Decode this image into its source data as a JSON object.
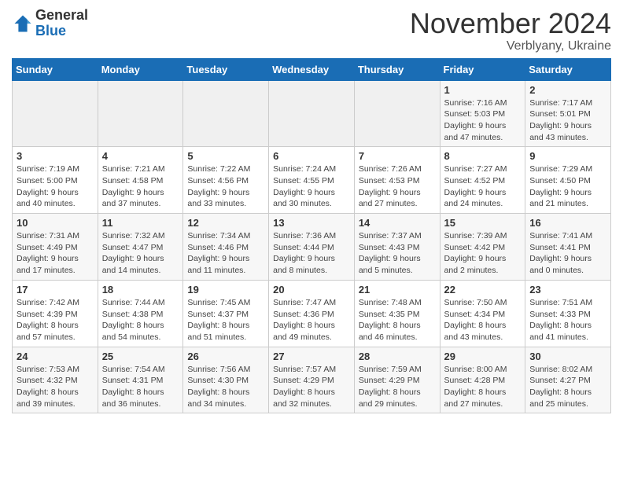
{
  "logo": {
    "general": "General",
    "blue": "Blue"
  },
  "title": "November 2024",
  "location": "Verblyany, Ukraine",
  "days_of_week": [
    "Sunday",
    "Monday",
    "Tuesday",
    "Wednesday",
    "Thursday",
    "Friday",
    "Saturday"
  ],
  "weeks": [
    [
      {
        "day": "",
        "info": ""
      },
      {
        "day": "",
        "info": ""
      },
      {
        "day": "",
        "info": ""
      },
      {
        "day": "",
        "info": ""
      },
      {
        "day": "",
        "info": ""
      },
      {
        "day": "1",
        "info": "Sunrise: 7:16 AM\nSunset: 5:03 PM\nDaylight: 9 hours\nand 47 minutes."
      },
      {
        "day": "2",
        "info": "Sunrise: 7:17 AM\nSunset: 5:01 PM\nDaylight: 9 hours\nand 43 minutes."
      }
    ],
    [
      {
        "day": "3",
        "info": "Sunrise: 7:19 AM\nSunset: 5:00 PM\nDaylight: 9 hours\nand 40 minutes."
      },
      {
        "day": "4",
        "info": "Sunrise: 7:21 AM\nSunset: 4:58 PM\nDaylight: 9 hours\nand 37 minutes."
      },
      {
        "day": "5",
        "info": "Sunrise: 7:22 AM\nSunset: 4:56 PM\nDaylight: 9 hours\nand 33 minutes."
      },
      {
        "day": "6",
        "info": "Sunrise: 7:24 AM\nSunset: 4:55 PM\nDaylight: 9 hours\nand 30 minutes."
      },
      {
        "day": "7",
        "info": "Sunrise: 7:26 AM\nSunset: 4:53 PM\nDaylight: 9 hours\nand 27 minutes."
      },
      {
        "day": "8",
        "info": "Sunrise: 7:27 AM\nSunset: 4:52 PM\nDaylight: 9 hours\nand 24 minutes."
      },
      {
        "day": "9",
        "info": "Sunrise: 7:29 AM\nSunset: 4:50 PM\nDaylight: 9 hours\nand 21 minutes."
      }
    ],
    [
      {
        "day": "10",
        "info": "Sunrise: 7:31 AM\nSunset: 4:49 PM\nDaylight: 9 hours\nand 17 minutes."
      },
      {
        "day": "11",
        "info": "Sunrise: 7:32 AM\nSunset: 4:47 PM\nDaylight: 9 hours\nand 14 minutes."
      },
      {
        "day": "12",
        "info": "Sunrise: 7:34 AM\nSunset: 4:46 PM\nDaylight: 9 hours\nand 11 minutes."
      },
      {
        "day": "13",
        "info": "Sunrise: 7:36 AM\nSunset: 4:44 PM\nDaylight: 9 hours\nand 8 minutes."
      },
      {
        "day": "14",
        "info": "Sunrise: 7:37 AM\nSunset: 4:43 PM\nDaylight: 9 hours\nand 5 minutes."
      },
      {
        "day": "15",
        "info": "Sunrise: 7:39 AM\nSunset: 4:42 PM\nDaylight: 9 hours\nand 2 minutes."
      },
      {
        "day": "16",
        "info": "Sunrise: 7:41 AM\nSunset: 4:41 PM\nDaylight: 9 hours\nand 0 minutes."
      }
    ],
    [
      {
        "day": "17",
        "info": "Sunrise: 7:42 AM\nSunset: 4:39 PM\nDaylight: 8 hours\nand 57 minutes."
      },
      {
        "day": "18",
        "info": "Sunrise: 7:44 AM\nSunset: 4:38 PM\nDaylight: 8 hours\nand 54 minutes."
      },
      {
        "day": "19",
        "info": "Sunrise: 7:45 AM\nSunset: 4:37 PM\nDaylight: 8 hours\nand 51 minutes."
      },
      {
        "day": "20",
        "info": "Sunrise: 7:47 AM\nSunset: 4:36 PM\nDaylight: 8 hours\nand 49 minutes."
      },
      {
        "day": "21",
        "info": "Sunrise: 7:48 AM\nSunset: 4:35 PM\nDaylight: 8 hours\nand 46 minutes."
      },
      {
        "day": "22",
        "info": "Sunrise: 7:50 AM\nSunset: 4:34 PM\nDaylight: 8 hours\nand 43 minutes."
      },
      {
        "day": "23",
        "info": "Sunrise: 7:51 AM\nSunset: 4:33 PM\nDaylight: 8 hours\nand 41 minutes."
      }
    ],
    [
      {
        "day": "24",
        "info": "Sunrise: 7:53 AM\nSunset: 4:32 PM\nDaylight: 8 hours\nand 39 minutes."
      },
      {
        "day": "25",
        "info": "Sunrise: 7:54 AM\nSunset: 4:31 PM\nDaylight: 8 hours\nand 36 minutes."
      },
      {
        "day": "26",
        "info": "Sunrise: 7:56 AM\nSunset: 4:30 PM\nDaylight: 8 hours\nand 34 minutes."
      },
      {
        "day": "27",
        "info": "Sunrise: 7:57 AM\nSunset: 4:29 PM\nDaylight: 8 hours\nand 32 minutes."
      },
      {
        "day": "28",
        "info": "Sunrise: 7:59 AM\nSunset: 4:29 PM\nDaylight: 8 hours\nand 29 minutes."
      },
      {
        "day": "29",
        "info": "Sunrise: 8:00 AM\nSunset: 4:28 PM\nDaylight: 8 hours\nand 27 minutes."
      },
      {
        "day": "30",
        "info": "Sunrise: 8:02 AM\nSunset: 4:27 PM\nDaylight: 8 hours\nand 25 minutes."
      }
    ]
  ]
}
